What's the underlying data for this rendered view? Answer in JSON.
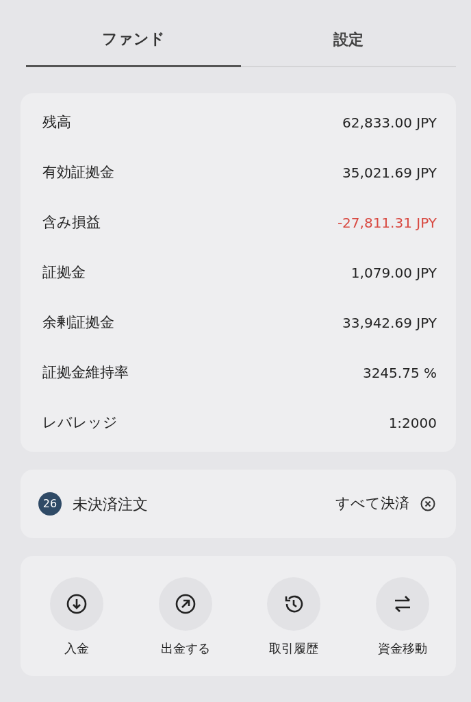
{
  "tabs": [
    {
      "label": "ファンド",
      "selected": true
    },
    {
      "label": "設定",
      "selected": false
    }
  ],
  "summary": [
    {
      "label": "残高",
      "value": "62,833.00 JPY",
      "negative": false
    },
    {
      "label": "有効証拠金",
      "value": "35,021.69 JPY",
      "negative": false
    },
    {
      "label": "含み損益",
      "value": "-27,811.31 JPY",
      "negative": true
    },
    {
      "label": "証拠金",
      "value": "1,079.00 JPY",
      "negative": false
    },
    {
      "label": "余剰証拠金",
      "value": "33,942.69 JPY",
      "negative": false
    },
    {
      "label": "証拠金維持率",
      "value": "3245.75 %",
      "negative": false
    },
    {
      "label": "レバレッジ",
      "value": "1:2000",
      "negative": false
    }
  ],
  "open_orders": {
    "count": "26",
    "label": "未決済注文",
    "close_all": "すべて決済"
  },
  "actions": [
    {
      "label": "入金"
    },
    {
      "label": "出金する"
    },
    {
      "label": "取引履歴"
    },
    {
      "label": "資金移動"
    }
  ]
}
